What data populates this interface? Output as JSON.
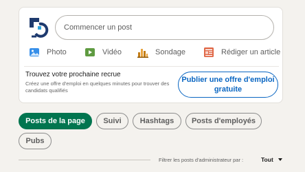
{
  "composer": {
    "placeholder": "Commencer un post",
    "actions": [
      {
        "label": "Photo",
        "icon": "photo-icon",
        "color": "#378fe9"
      },
      {
        "label": "Vidéo",
        "icon": "video-icon",
        "color": "#5f9b41"
      },
      {
        "label": "Sondage",
        "icon": "poll-icon",
        "color": "#c37d16"
      },
      {
        "label": "Rédiger un article",
        "icon": "article-icon",
        "color": "#e06847"
      }
    ]
  },
  "recruit": {
    "title": "Trouvez votre prochaine recrue",
    "subtitle": "Créez une offre d'emploi en quelques minutes pour trouver des candidats qualifiés",
    "button": "Publier une offre d'emploi gratuite"
  },
  "tabs": [
    {
      "label": "Posts de la page",
      "active": true
    },
    {
      "label": "Suivi",
      "active": false
    },
    {
      "label": "Hashtags",
      "active": false
    },
    {
      "label": "Posts d'employés",
      "active": false
    },
    {
      "label": "Pubs",
      "active": false
    }
  ],
  "filter": {
    "label": "Filtrer les posts d'administrateur par :",
    "value": "Tout"
  },
  "colors": {
    "accent": "#0a66c2",
    "active_tab": "#01754f",
    "background": "#f4f2ee"
  }
}
